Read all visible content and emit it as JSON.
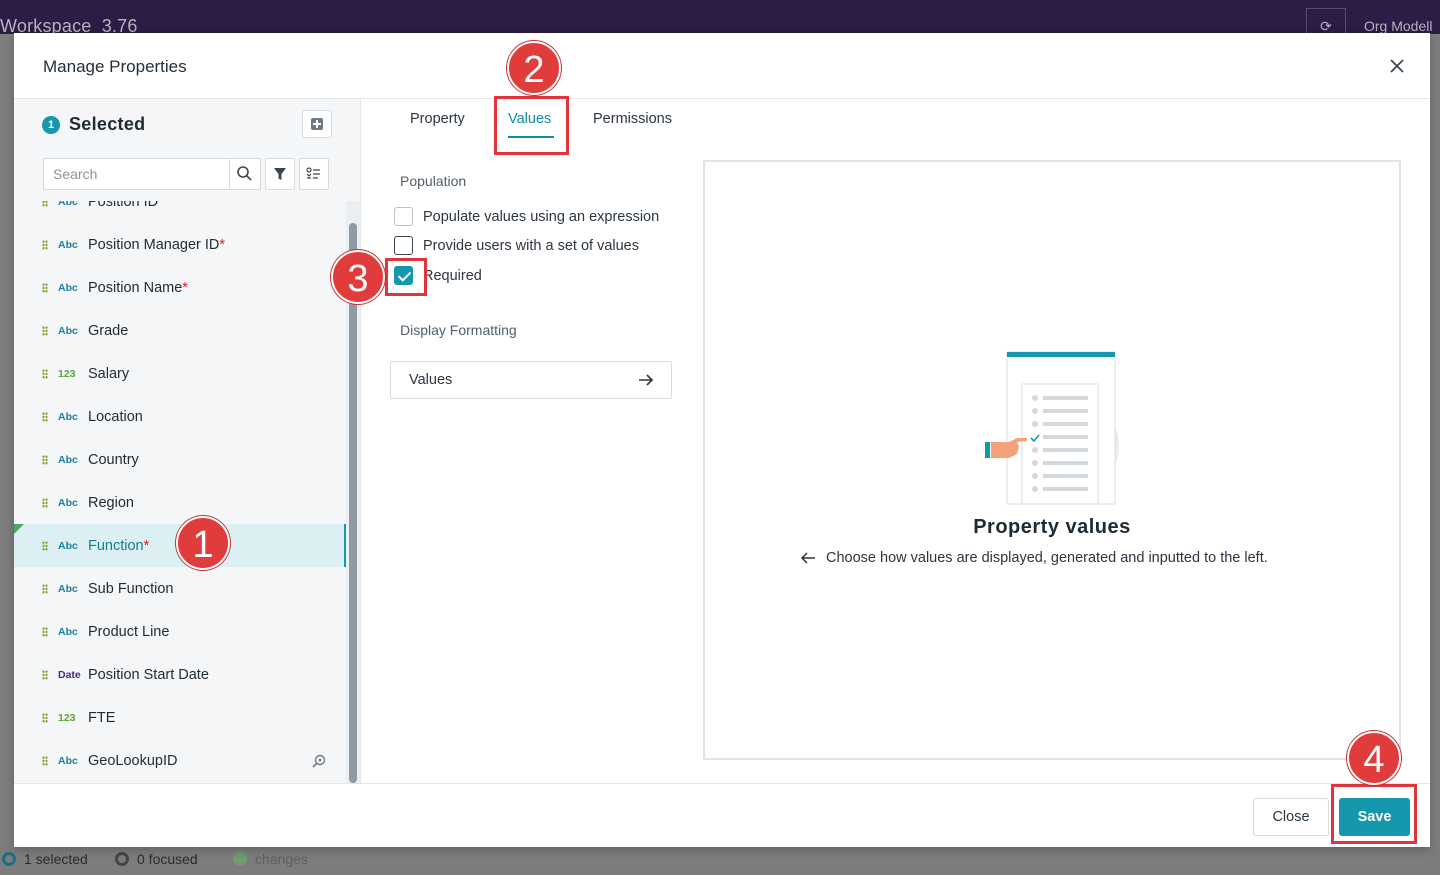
{
  "background_app": {
    "title": "Workspace_3.76",
    "right_text": "Org Modell",
    "status": {
      "selected": "1 selected",
      "focused": "0 focused",
      "changes": "changes"
    }
  },
  "modal": {
    "title": "Manage Properties",
    "left_panel": {
      "selected_count": "1",
      "selected_title": "Selected",
      "search_placeholder": "Search",
      "items": [
        {
          "type": "Abc",
          "label": "Position ID",
          "required": false
        },
        {
          "type": "Abc",
          "label": "Position Manager ID",
          "required": true
        },
        {
          "type": "Abc",
          "label": "Position Name",
          "required": true
        },
        {
          "type": "Abc",
          "label": "Grade",
          "required": false
        },
        {
          "type": "123",
          "label": "Salary",
          "required": false
        },
        {
          "type": "Abc",
          "label": "Location",
          "required": false
        },
        {
          "type": "Abc",
          "label": "Country",
          "required": false
        },
        {
          "type": "Abc",
          "label": "Region",
          "required": false
        },
        {
          "type": "Abc",
          "label": "Function",
          "required": true,
          "active": true
        },
        {
          "type": "Abc",
          "label": "Sub Function",
          "required": false
        },
        {
          "type": "Abc",
          "label": "Product Line",
          "required": false
        },
        {
          "type": "Date",
          "label": "Position Start Date",
          "required": false
        },
        {
          "type": "123",
          "label": "FTE",
          "required": false
        },
        {
          "type": "Abc",
          "label": "GeoLookupID",
          "required": false
        }
      ],
      "required_mark": "*"
    },
    "tabs": [
      {
        "label": "Property"
      },
      {
        "label": "Values",
        "active": true
      },
      {
        "label": "Permissions"
      }
    ],
    "population": {
      "heading": "Population",
      "options": [
        {
          "label": "Populate values using an expression",
          "checked": false
        },
        {
          "label": "Provide users with a set of values",
          "checked": false
        },
        {
          "label": "Required",
          "checked": true
        }
      ]
    },
    "display_formatting": {
      "heading": "Display Formatting",
      "values_button": "Values"
    },
    "placeholder": {
      "title": "Property values",
      "subtitle": "Choose how values are displayed, generated and inputted to the left."
    },
    "footer": {
      "close_label": "Close",
      "save_label": "Save"
    }
  },
  "annotations": [
    "1",
    "2",
    "3",
    "4"
  ],
  "colors": {
    "accent": "#1597ad",
    "annotation": "#e03c3c",
    "required": "#d2232a",
    "topbar": "#2d1c45"
  }
}
